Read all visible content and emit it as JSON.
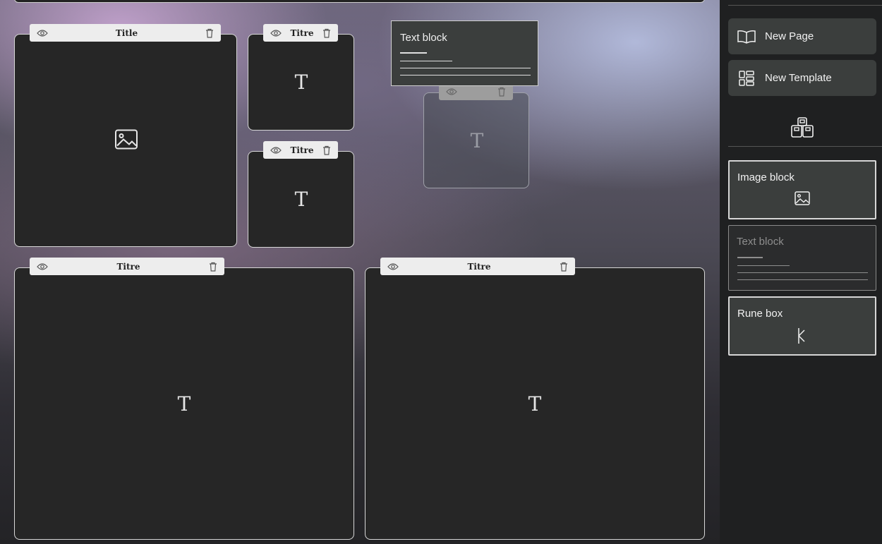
{
  "canvas": {
    "blocks": [
      {
        "title": "Title",
        "type": "image"
      },
      {
        "title": "Titre",
        "type": "text"
      },
      {
        "title": "Titre",
        "type": "text"
      },
      {
        "title": "Titre",
        "type": "text"
      },
      {
        "title": "Titre",
        "type": "text"
      }
    ],
    "text_glyph": "T",
    "drag_preview": {
      "label": "Text block",
      "ghost_glyph": "T"
    }
  },
  "sidebar": {
    "new_page_label": "New Page",
    "new_template_label": "New Template",
    "blocks": [
      {
        "label": "Image block",
        "icon": "image-icon"
      },
      {
        "label": "Text block",
        "icon": "text-lines-icon",
        "state": "disabled"
      },
      {
        "label": "Rune box",
        "icon": "rune-icon"
      }
    ]
  },
  "colors": {
    "block_bg": "#262626",
    "block_border": "#d8d8d8",
    "tab_bg": "#ededed",
    "sidebar_bg": "#1f2021",
    "sidebar_button_bg": "#3b3e3d"
  }
}
